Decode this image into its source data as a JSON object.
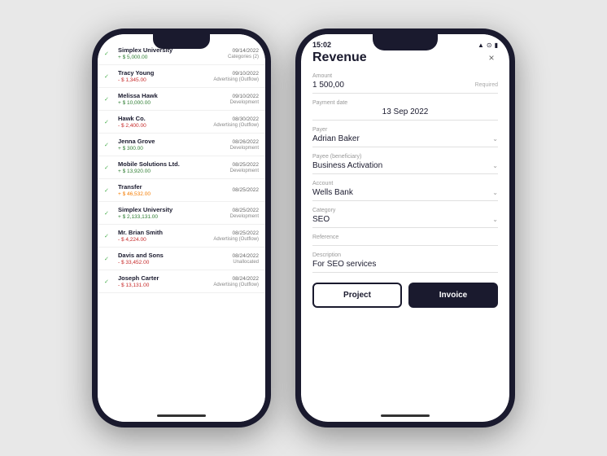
{
  "left_phone": {
    "transactions": [
      {
        "name": "Simplex University",
        "amount": "+ $ 5,000.00",
        "type": "positive",
        "date": "09/14/2022",
        "category": "Categories (2)",
        "checked": true
      },
      {
        "name": "Tracy Young",
        "amount": "- $ 1,345.00",
        "type": "negative",
        "date": "09/10/2022",
        "category": "Advertising (Outflow)",
        "checked": true
      },
      {
        "name": "Melissa Hawk",
        "amount": "+ $ 10,000.00",
        "type": "positive",
        "date": "09/10/2022",
        "category": "Development",
        "checked": true
      },
      {
        "name": "Hawk Co.",
        "amount": "- $ 2,400.00",
        "type": "negative",
        "date": "08/30/2022",
        "category": "Advertising (Outflow)",
        "checked": true
      },
      {
        "name": "Jenna Grove",
        "amount": "+ $ 300.00",
        "type": "positive",
        "date": "08/26/2022",
        "category": "Development",
        "checked": true
      },
      {
        "name": "Mobile Solutions Ltd.",
        "amount": "+ $ 13,920.00",
        "type": "positive",
        "date": "08/25/2022",
        "category": "Development",
        "checked": true
      },
      {
        "name": "Transfer",
        "amount": "+ $ 46,532.00",
        "type": "transfer",
        "date": "08/25/2022",
        "category": "",
        "checked": true
      },
      {
        "name": "Simplex University",
        "amount": "+ $ 2,133,131.00",
        "type": "positive",
        "date": "08/25/2022",
        "category": "Development",
        "checked": true
      },
      {
        "name": "Mr. Brian Smith",
        "amount": "- $ 4,224.00",
        "type": "negative",
        "date": "08/25/2022",
        "category": "Advertising (Outflow)",
        "checked": true
      },
      {
        "name": "Davis and Sons",
        "amount": "- $ 33,452.00",
        "type": "negative",
        "date": "08/24/2022",
        "category": "Unallocated",
        "checked": true
      },
      {
        "name": "Joseph Carter",
        "amount": "- $ 13,131.00",
        "type": "negative",
        "date": "08/24/2022",
        "category": "Advertising (Outflow)",
        "checked": true
      }
    ]
  },
  "right_phone": {
    "status_bar": {
      "time": "15:02"
    },
    "form": {
      "title": "Revenue",
      "close_label": "×",
      "fields": [
        {
          "label": "Amount",
          "value": "1 500,00",
          "extra": "Required",
          "type": "amount"
        },
        {
          "label": "Payment date",
          "value": "13 Sep 2022",
          "type": "date"
        },
        {
          "label": "Payer",
          "value": "Adrian Baker",
          "type": "select"
        },
        {
          "label": "Payee (beneficiary)",
          "value": "Business Activation",
          "type": "select"
        },
        {
          "label": "Account",
          "value": "Wells Bank",
          "type": "select"
        },
        {
          "label": "Category",
          "value": "SEO",
          "type": "select"
        },
        {
          "label": "Reference",
          "value": "",
          "type": "text"
        },
        {
          "label": "Description",
          "value": "For SEO services",
          "type": "text"
        }
      ],
      "buttons": [
        {
          "label": "Project",
          "type": "outline"
        },
        {
          "label": "Invoice",
          "type": "solid"
        }
      ]
    }
  }
}
